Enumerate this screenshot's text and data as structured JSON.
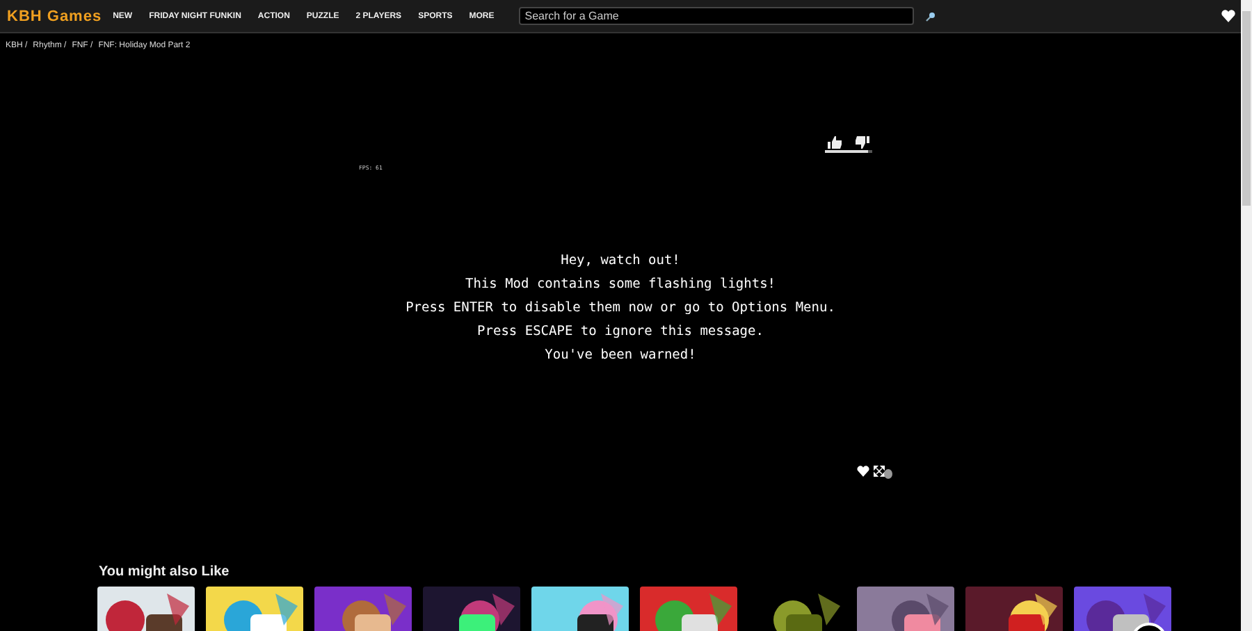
{
  "header": {
    "logo": "KBH Games",
    "nav": [
      "NEW",
      "FRIDAY NIGHT FUNKIN",
      "ACTION",
      "PUZZLE",
      "2 PLAYERS",
      "SPORTS",
      "MORE"
    ],
    "search": {
      "placeholder": "Search for a Game"
    }
  },
  "breadcrumb": [
    "KBH /",
    "Rhythm /",
    "FNF /",
    "FNF: Holiday Mod Part 2"
  ],
  "game": {
    "fps": "FPS: 61",
    "rating": {
      "level": 0.9
    },
    "message": [
      "Hey, watch out!",
      "This Mod contains some flashing lights!",
      "Press ENTER to disable them now or go to Options Menu.",
      "Press ESCAPE to ignore this message.",
      "You've been warned!"
    ]
  },
  "related": {
    "title": "You might also Like"
  }
}
